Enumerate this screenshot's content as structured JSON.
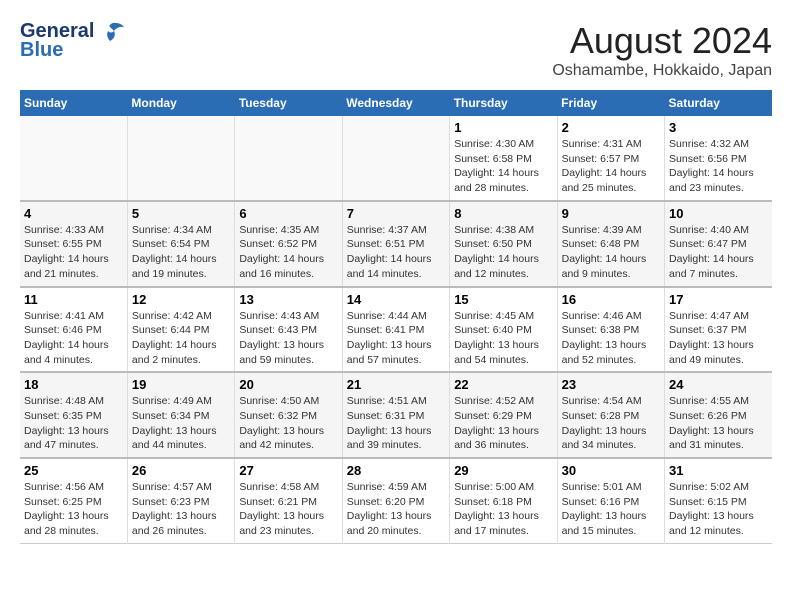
{
  "header": {
    "logo_line1": "General",
    "logo_line2": "Blue",
    "main_title": "August 2024",
    "subtitle": "Oshamambe, Hokkaido, Japan"
  },
  "days_of_week": [
    "Sunday",
    "Monday",
    "Tuesday",
    "Wednesday",
    "Thursday",
    "Friday",
    "Saturday"
  ],
  "weeks": [
    [
      {
        "num": "",
        "info": ""
      },
      {
        "num": "",
        "info": ""
      },
      {
        "num": "",
        "info": ""
      },
      {
        "num": "",
        "info": ""
      },
      {
        "num": "1",
        "info": "Sunrise: 4:30 AM\nSunset: 6:58 PM\nDaylight: 14 hours\nand 28 minutes."
      },
      {
        "num": "2",
        "info": "Sunrise: 4:31 AM\nSunset: 6:57 PM\nDaylight: 14 hours\nand 25 minutes."
      },
      {
        "num": "3",
        "info": "Sunrise: 4:32 AM\nSunset: 6:56 PM\nDaylight: 14 hours\nand 23 minutes."
      }
    ],
    [
      {
        "num": "4",
        "info": "Sunrise: 4:33 AM\nSunset: 6:55 PM\nDaylight: 14 hours\nand 21 minutes."
      },
      {
        "num": "5",
        "info": "Sunrise: 4:34 AM\nSunset: 6:54 PM\nDaylight: 14 hours\nand 19 minutes."
      },
      {
        "num": "6",
        "info": "Sunrise: 4:35 AM\nSunset: 6:52 PM\nDaylight: 14 hours\nand 16 minutes."
      },
      {
        "num": "7",
        "info": "Sunrise: 4:37 AM\nSunset: 6:51 PM\nDaylight: 14 hours\nand 14 minutes."
      },
      {
        "num": "8",
        "info": "Sunrise: 4:38 AM\nSunset: 6:50 PM\nDaylight: 14 hours\nand 12 minutes."
      },
      {
        "num": "9",
        "info": "Sunrise: 4:39 AM\nSunset: 6:48 PM\nDaylight: 14 hours\nand 9 minutes."
      },
      {
        "num": "10",
        "info": "Sunrise: 4:40 AM\nSunset: 6:47 PM\nDaylight: 14 hours\nand 7 minutes."
      }
    ],
    [
      {
        "num": "11",
        "info": "Sunrise: 4:41 AM\nSunset: 6:46 PM\nDaylight: 14 hours\nand 4 minutes."
      },
      {
        "num": "12",
        "info": "Sunrise: 4:42 AM\nSunset: 6:44 PM\nDaylight: 14 hours\nand 2 minutes."
      },
      {
        "num": "13",
        "info": "Sunrise: 4:43 AM\nSunset: 6:43 PM\nDaylight: 13 hours\nand 59 minutes."
      },
      {
        "num": "14",
        "info": "Sunrise: 4:44 AM\nSunset: 6:41 PM\nDaylight: 13 hours\nand 57 minutes."
      },
      {
        "num": "15",
        "info": "Sunrise: 4:45 AM\nSunset: 6:40 PM\nDaylight: 13 hours\nand 54 minutes."
      },
      {
        "num": "16",
        "info": "Sunrise: 4:46 AM\nSunset: 6:38 PM\nDaylight: 13 hours\nand 52 minutes."
      },
      {
        "num": "17",
        "info": "Sunrise: 4:47 AM\nSunset: 6:37 PM\nDaylight: 13 hours\nand 49 minutes."
      }
    ],
    [
      {
        "num": "18",
        "info": "Sunrise: 4:48 AM\nSunset: 6:35 PM\nDaylight: 13 hours\nand 47 minutes."
      },
      {
        "num": "19",
        "info": "Sunrise: 4:49 AM\nSunset: 6:34 PM\nDaylight: 13 hours\nand 44 minutes."
      },
      {
        "num": "20",
        "info": "Sunrise: 4:50 AM\nSunset: 6:32 PM\nDaylight: 13 hours\nand 42 minutes."
      },
      {
        "num": "21",
        "info": "Sunrise: 4:51 AM\nSunset: 6:31 PM\nDaylight: 13 hours\nand 39 minutes."
      },
      {
        "num": "22",
        "info": "Sunrise: 4:52 AM\nSunset: 6:29 PM\nDaylight: 13 hours\nand 36 minutes."
      },
      {
        "num": "23",
        "info": "Sunrise: 4:54 AM\nSunset: 6:28 PM\nDaylight: 13 hours\nand 34 minutes."
      },
      {
        "num": "24",
        "info": "Sunrise: 4:55 AM\nSunset: 6:26 PM\nDaylight: 13 hours\nand 31 minutes."
      }
    ],
    [
      {
        "num": "25",
        "info": "Sunrise: 4:56 AM\nSunset: 6:25 PM\nDaylight: 13 hours\nand 28 minutes."
      },
      {
        "num": "26",
        "info": "Sunrise: 4:57 AM\nSunset: 6:23 PM\nDaylight: 13 hours\nand 26 minutes."
      },
      {
        "num": "27",
        "info": "Sunrise: 4:58 AM\nSunset: 6:21 PM\nDaylight: 13 hours\nand 23 minutes."
      },
      {
        "num": "28",
        "info": "Sunrise: 4:59 AM\nSunset: 6:20 PM\nDaylight: 13 hours\nand 20 minutes."
      },
      {
        "num": "29",
        "info": "Sunrise: 5:00 AM\nSunset: 6:18 PM\nDaylight: 13 hours\nand 17 minutes."
      },
      {
        "num": "30",
        "info": "Sunrise: 5:01 AM\nSunset: 6:16 PM\nDaylight: 13 hours\nand 15 minutes."
      },
      {
        "num": "31",
        "info": "Sunrise: 5:02 AM\nSunset: 6:15 PM\nDaylight: 13 hours\nand 12 minutes."
      }
    ]
  ]
}
